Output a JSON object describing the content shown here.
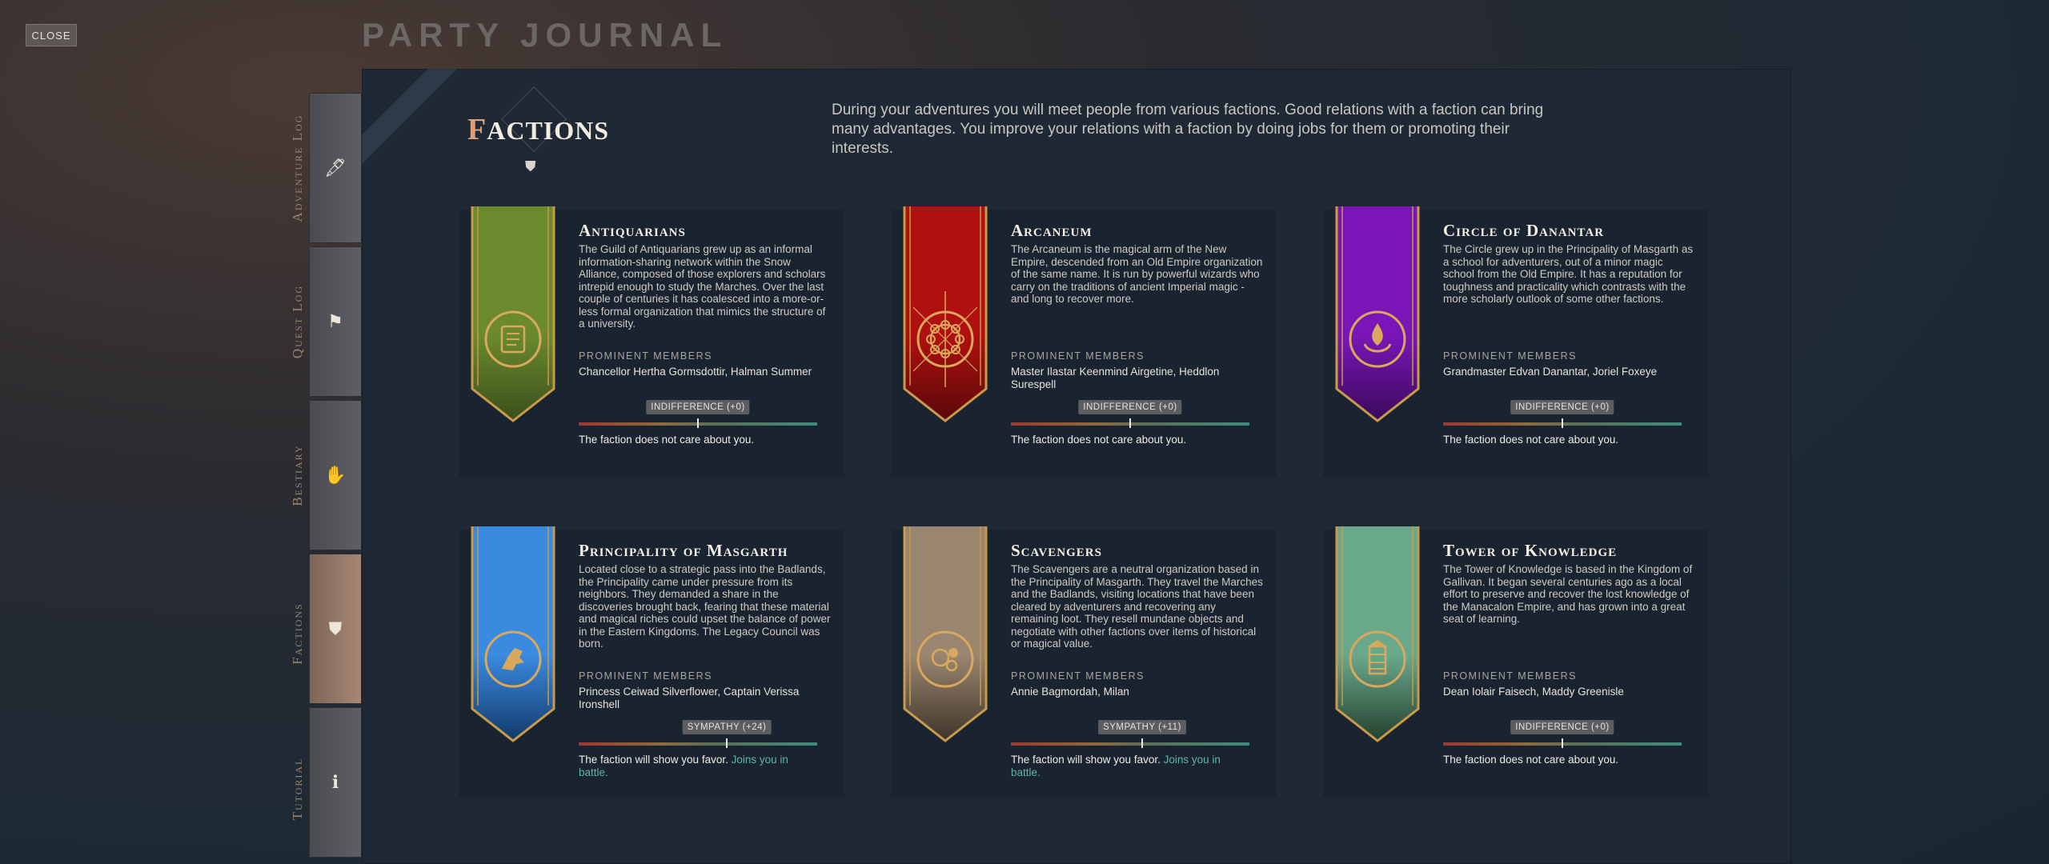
{
  "close_label": "CLOSE",
  "journal_title": "PARTY JOURNAL",
  "tabs": [
    {
      "label": "Adventure Log",
      "icon": "quill-icon",
      "glyph": "🖋"
    },
    {
      "label": "Quest Log",
      "icon": "flag-icon",
      "glyph": "⚑"
    },
    {
      "label": "Bestiary",
      "icon": "claw-icon",
      "glyph": "✋"
    },
    {
      "label": "Factions",
      "icon": "banner-icon",
      "glyph": "⛊"
    },
    {
      "label": "Tutorial",
      "icon": "info-icon",
      "glyph": "ℹ"
    }
  ],
  "active_tab": "Factions",
  "header": {
    "title_first": "F",
    "title_rest": "ACTIONS",
    "intro": "During your adventures you will meet people from various factions. Good relations with a faction can bring many advantages. You improve your relations with a faction by doing jobs for them or promoting their interests."
  },
  "prominent_members_label": "PROMINENT MEMBERS",
  "factions": [
    {
      "name": "Antiquarians",
      "description": "The Guild of Antiquarians grew up as an informal information-sharing network within the Snow Alliance, composed of those explorers and scholars intrepid enough to study the Marches. Over the last couple of centuries it has coalesced into a more-or-less formal organization that mimics the structure of a university.",
      "members": "Chancellor Hertha Gormsdottir, Halman Summer",
      "reputation": "INDIFFERENCE (+0)",
      "reputation_level": 0.5,
      "status": "The faction does not care about you.",
      "status_extra": "",
      "banner_color": "#6b8a2e",
      "banner_dark": "#3a4f1a",
      "emblem": "scroll-emblem-icon"
    },
    {
      "name": "Arcaneum",
      "description": "The Arcaneum is the magical arm of the New Empire, descended from an Old Empire organization of the same name. It is run by powerful wizards who carry on the traditions of ancient Imperial magic - and long to recover more.",
      "members": "Master Ilastar Keenmind Airgetine, Heddlon Surespell",
      "reputation": "INDIFFERENCE (+0)",
      "reputation_level": 0.5,
      "status": "The faction does not care about you.",
      "status_extra": "",
      "banner_color": "#b01010",
      "banner_dark": "#5a0808",
      "emblem": "orb-ring-emblem-icon"
    },
    {
      "name": "Circle of Danantar",
      "description": "The Circle grew up in the Principality of Masgarth as a school for adventurers, out of a minor magic school from the Old Empire. It has a reputation for toughness and practicality which contrasts with the more scholarly outlook of some other factions.",
      "members": "Grandmaster Edvan Danantar, Joriel Foxeye",
      "reputation": "INDIFFERENCE (+0)",
      "reputation_level": 0.5,
      "status": "The faction does not care about you.",
      "status_extra": "",
      "banner_color": "#7a16b8",
      "banner_dark": "#3a0a5a",
      "emblem": "flame-hands-emblem-icon"
    },
    {
      "name": "Principality of Masgarth",
      "description": "Located close to a strategic pass into the Badlands, the Principality came under pressure from its neighbors. They demanded a share in the discoveries brought back, fearing that these material and magical riches could upset the balance of power in the Eastern Kingdoms. The Legacy Council was born.",
      "members": "Princess Ceiwad Silverflower, Captain Verissa Ironshell",
      "reputation": "SYMPATHY (+24)",
      "reputation_level": 0.62,
      "status": "The faction will show you favor.",
      "status_extra": "Joins you in battle.",
      "banner_color": "#3a8ae0",
      "banner_dark": "#123a6a",
      "emblem": "horse-emblem-icon"
    },
    {
      "name": "Scavengers",
      "description": "The Scavengers are a neutral organization based in the Principality of Masgarth. They travel the Marches and the Badlands, visiting locations that have been cleared by adventurers and recovering any remaining loot. They resell mundane objects and negotiate with other factions over items of historical or magical value.",
      "members": "Annie Bagmordah, Milan",
      "reputation": "SYMPATHY (+11)",
      "reputation_level": 0.55,
      "status": "The faction will show you favor.",
      "status_extra": "Joins you in battle.",
      "banner_color": "#9a8670",
      "banner_dark": "#3e342a",
      "emblem": "scavenger-emblem-icon"
    },
    {
      "name": "Tower of Knowledge",
      "description": "The Tower of Knowledge is based in the Kingdom of Gallivan. It began several centuries ago as a local effort to preserve and recover the lost knowledge of the Manacalon Empire, and has grown into a great seat of learning.",
      "members": "Dean Iolair Faisech, Maddy Greenisle",
      "reputation": "INDIFFERENCE (+0)",
      "reputation_level": 0.5,
      "status": "The faction does not care about you.",
      "status_extra": "",
      "banner_color": "#6aa88c",
      "banner_dark": "#24402f",
      "emblem": "tower-emblem-icon"
    }
  ]
}
